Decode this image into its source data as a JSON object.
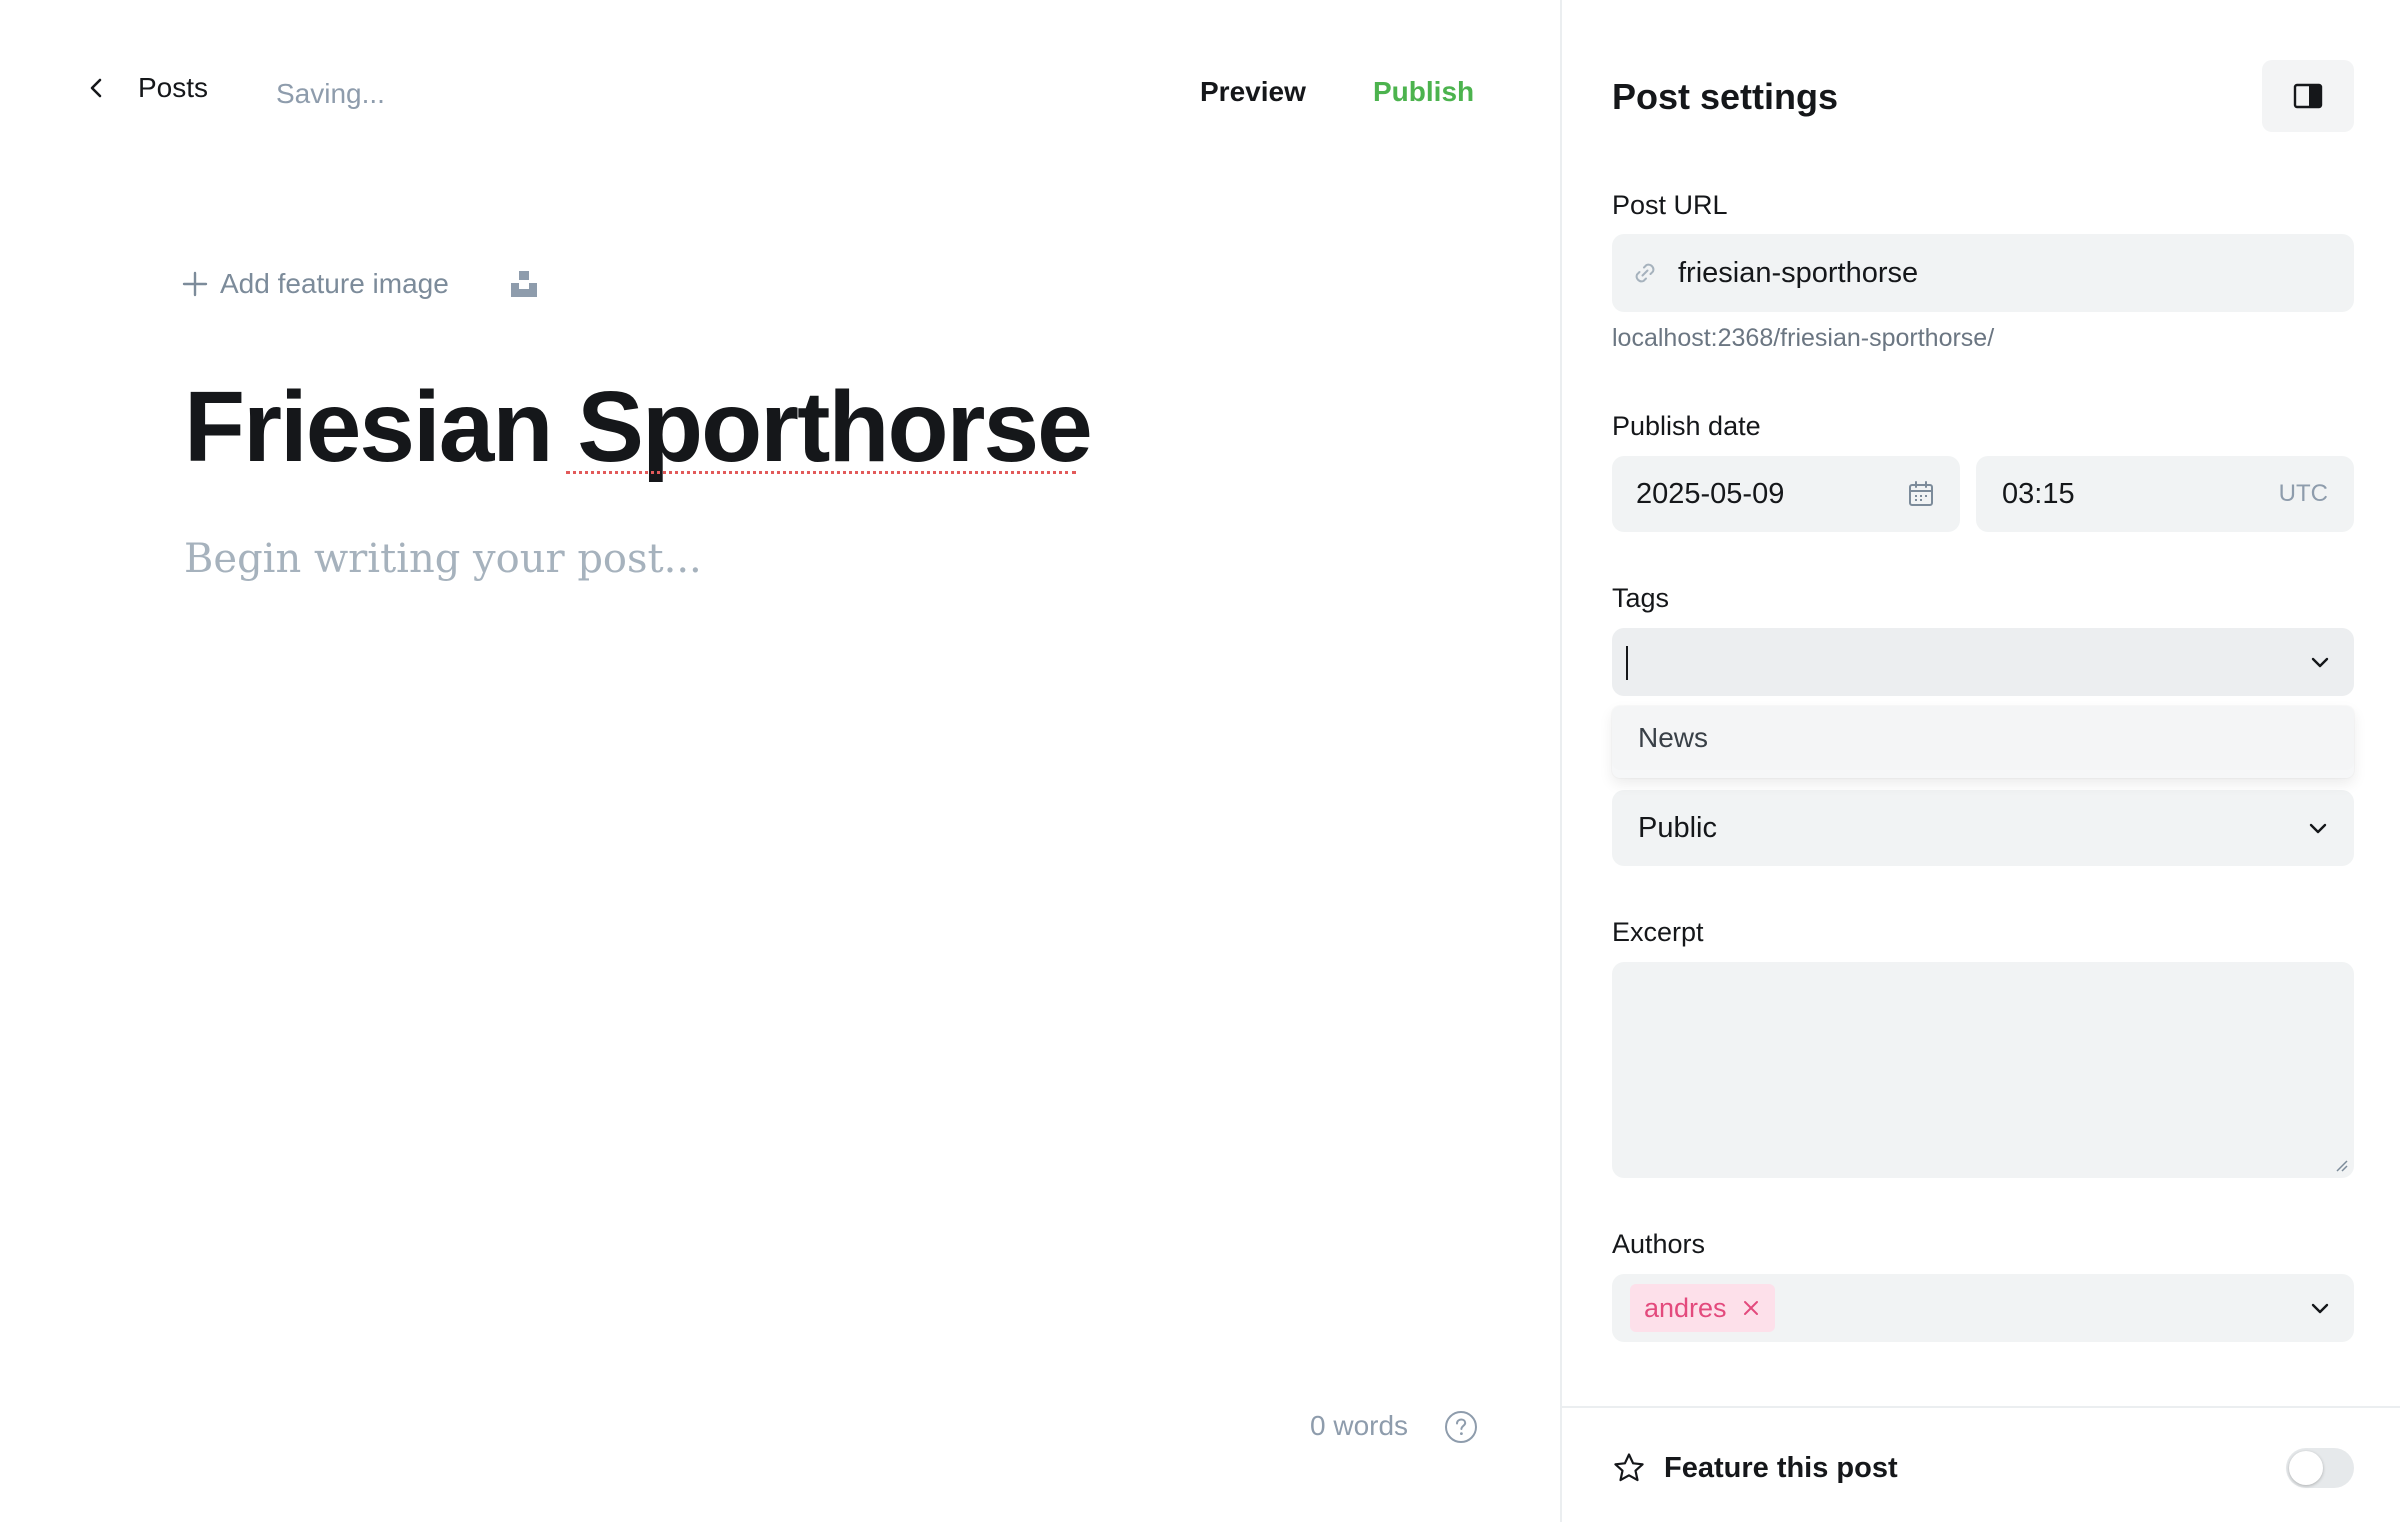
{
  "header": {
    "back_label": "Posts",
    "status": "Saving...",
    "preview_label": "Preview",
    "publish_label": "Publish"
  },
  "editor": {
    "feature_image_label": "Add feature image",
    "title": "Friesian Sporthorse",
    "body_placeholder": "Begin writing your post...",
    "word_count": "0 words"
  },
  "settings": {
    "title": "Post settings",
    "post_url": {
      "label": "Post URL",
      "value": "friesian-sporthorse",
      "full_url": "localhost:2368/friesian-sporthorse/"
    },
    "publish_date": {
      "label": "Publish date",
      "date": "2025-05-09",
      "time": "03:15",
      "timezone": "UTC"
    },
    "tags": {
      "label": "Tags",
      "value": "",
      "options": [
        "News"
      ]
    },
    "visibility": {
      "value": "Public"
    },
    "excerpt": {
      "label": "Excerpt",
      "value": ""
    },
    "authors": {
      "label": "Authors",
      "items": [
        "andres"
      ]
    },
    "feature_post": {
      "label": "Feature this post",
      "enabled": false
    }
  },
  "colors": {
    "publish_accent": "#4cb34e",
    "author_chip_bg": "#fde0ea",
    "author_chip_text": "#e34a7d",
    "field_bg": "#f1f3f4"
  },
  "icons": [
    "chevron-left-icon",
    "plus-icon",
    "unsplash-icon",
    "help-icon",
    "sidebar-toggle-icon",
    "link-icon",
    "calendar-icon",
    "chevron-down-icon",
    "close-icon",
    "star-icon"
  ]
}
